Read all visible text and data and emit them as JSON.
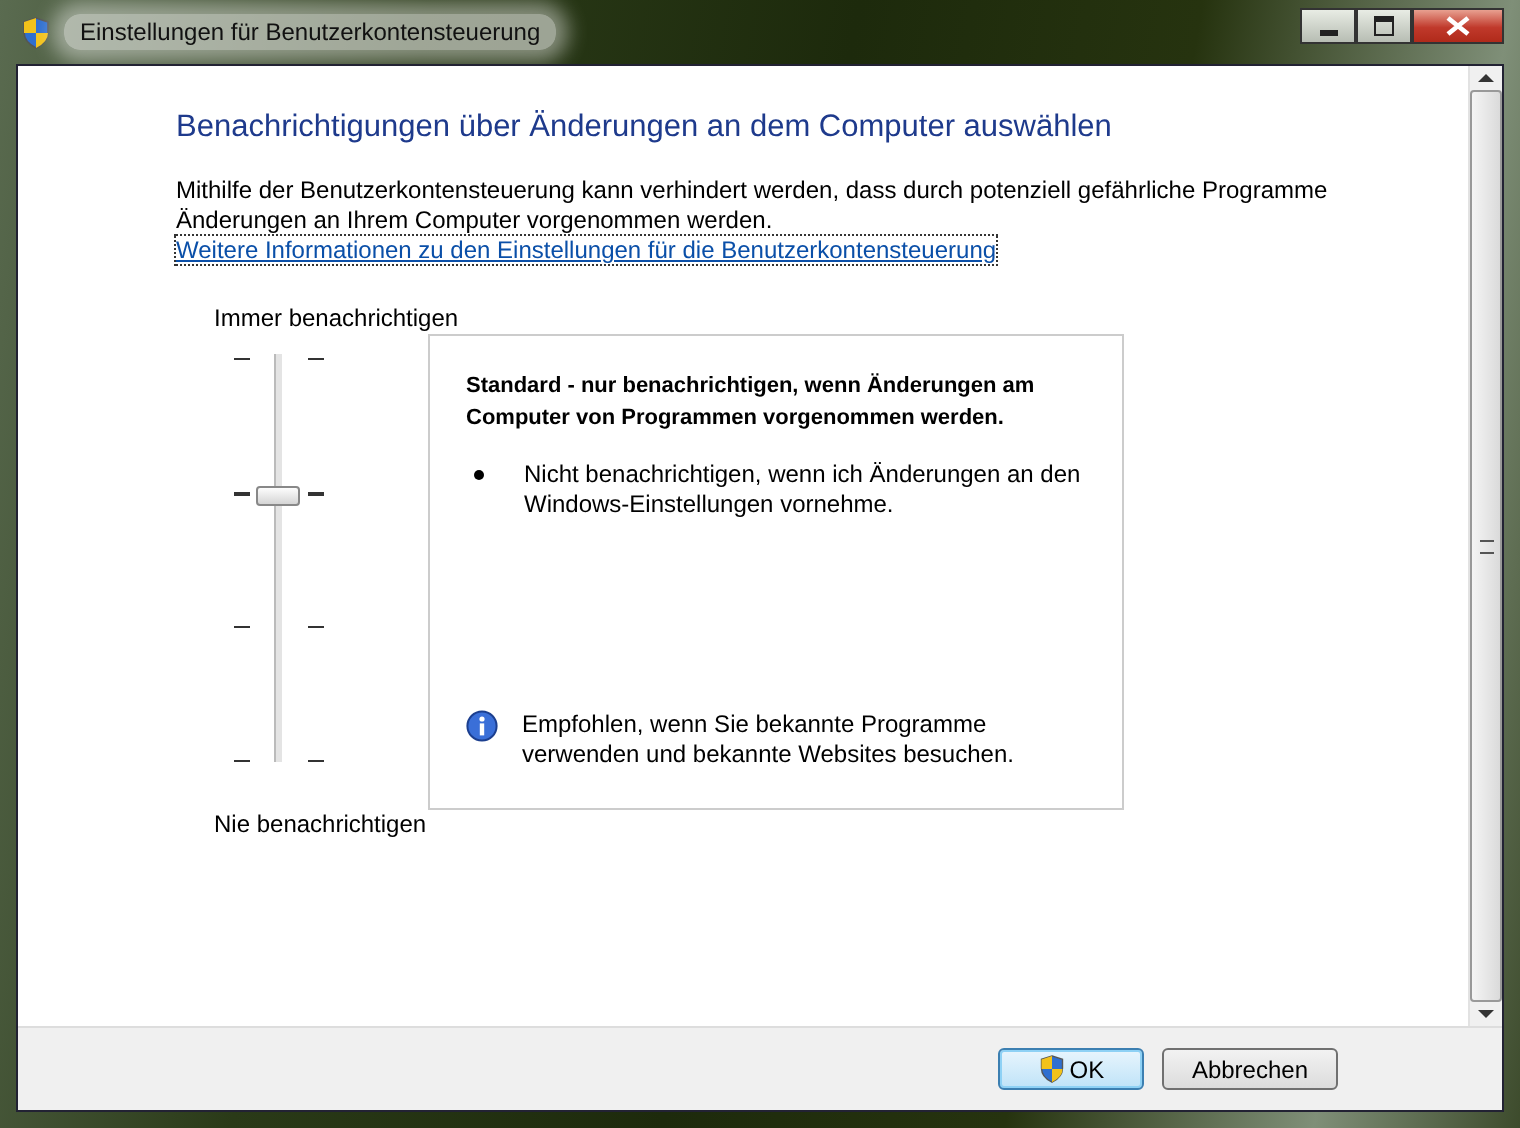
{
  "window": {
    "title": "Einstellungen für Benutzerkontensteuerung"
  },
  "heading": "Benachrichtigungen über Änderungen an dem Computer auswählen",
  "description": "Mithilfe der Benutzerkontensteuerung kann verhindert werden, dass durch potenziell gefährliche Programme Änderungen an Ihrem Computer vorgenommen werden.",
  "link": "Weitere Informationen zu den Einstellungen für die Benutzerkontensteuerung",
  "slider": {
    "top_label": "Immer benachrichtigen",
    "bottom_label": "Nie benachrichtigen",
    "level": 0.667
  },
  "info": {
    "title": "Standard - nur benachrichtigen, wenn Änderungen am Computer von Programmen vorgenommen werden.",
    "bullets": [
      "Nicht benachrichtigen, wenn ich Änderungen an den Windows-Einstellungen vornehme."
    ],
    "note": "Empfohlen, wenn Sie bekannte Programme verwenden und bekannte Websites besuchen."
  },
  "buttons": [
    {
      "label": "OK",
      "kind": "shield",
      "default": true
    },
    {
      "label": "Abbrechen",
      "kind": "plain",
      "default": false
    }
  ]
}
